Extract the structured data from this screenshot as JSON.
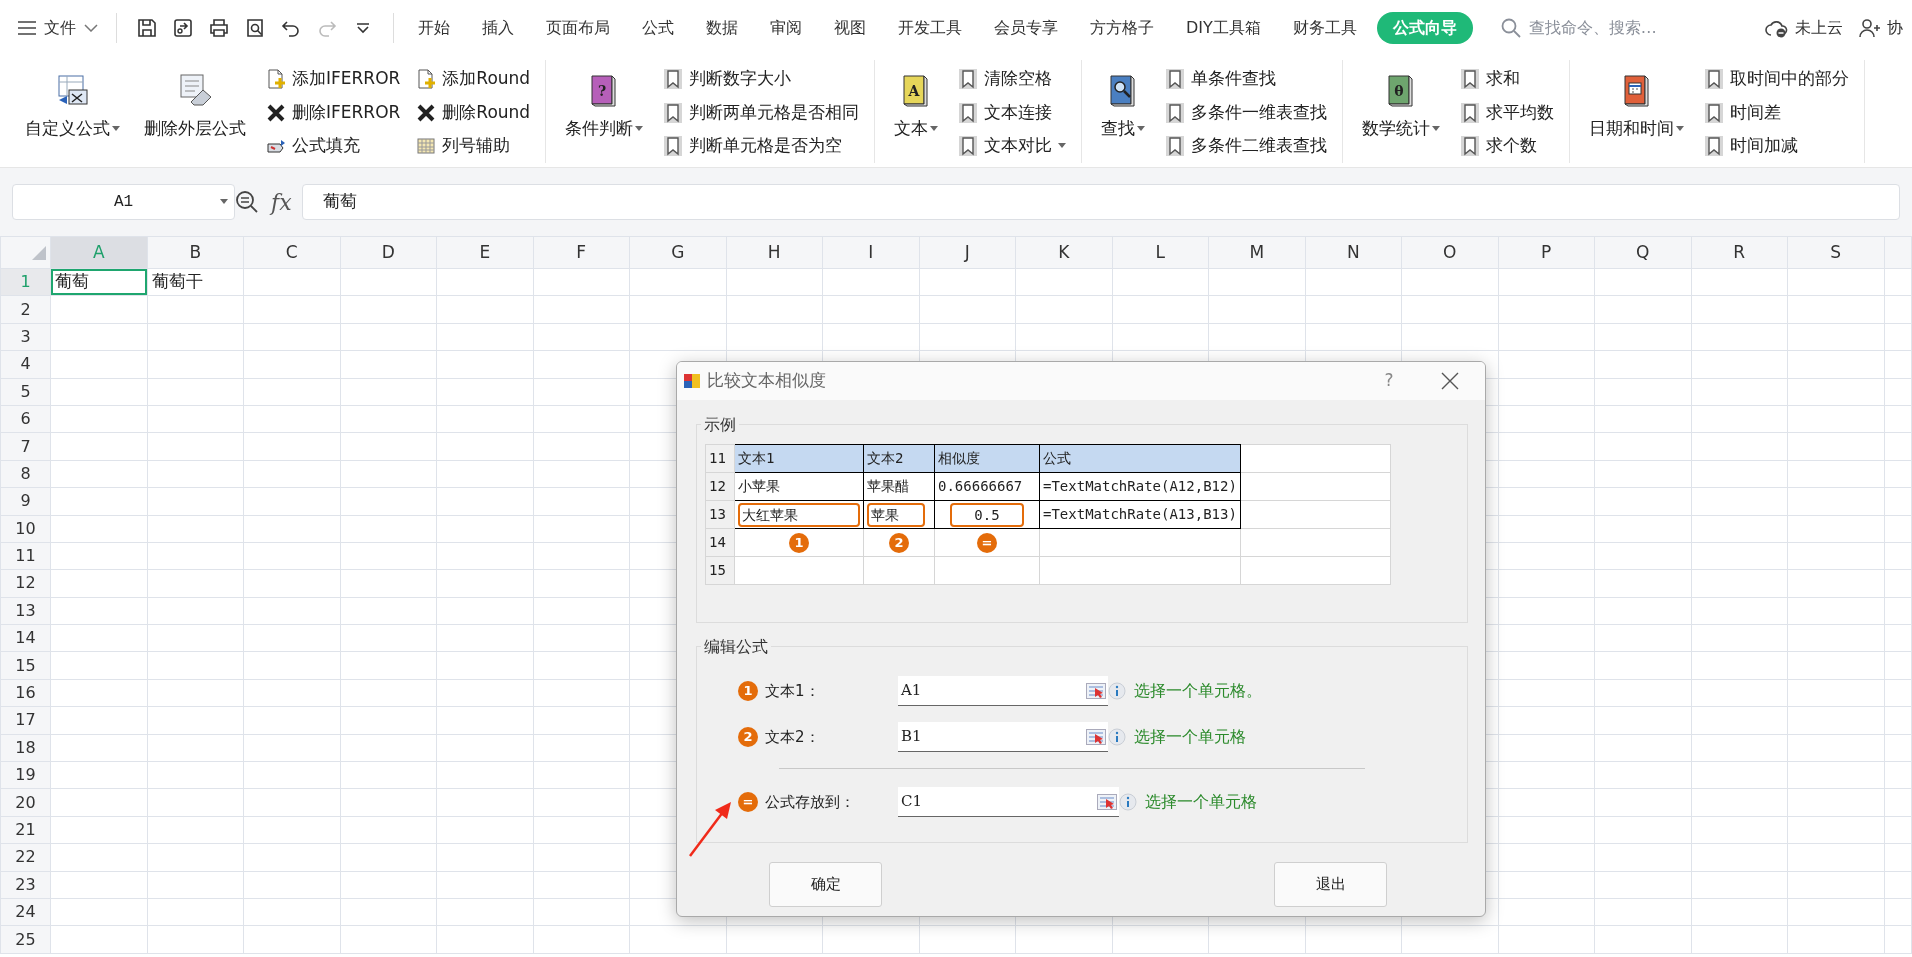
{
  "app_menu": {
    "label": "文件"
  },
  "menu_tabs": [
    {
      "label": "开始",
      "selected": false
    },
    {
      "label": "插入",
      "selected": false
    },
    {
      "label": "页面布局",
      "selected": false
    },
    {
      "label": "公式",
      "selected": false
    },
    {
      "label": "数据",
      "selected": false
    },
    {
      "label": "审阅",
      "selected": false
    },
    {
      "label": "视图",
      "selected": false
    },
    {
      "label": "开发工具",
      "selected": false
    },
    {
      "label": "会员专享",
      "selected": false
    },
    {
      "label": "方方格子",
      "selected": false
    },
    {
      "label": "DIY工具箱",
      "selected": false
    },
    {
      "label": "财务工具",
      "selected": false
    },
    {
      "label": "公式向导",
      "selected": true
    }
  ],
  "search": {
    "placeholder": "查找命令、搜索…"
  },
  "cloud_status": "未上云",
  "collaborate": "协",
  "ribbon": [
    {
      "large": [
        {
          "label": "自定义公式",
          "dropdown": true
        },
        {
          "label": "删除外层公式",
          "dropdown": false
        }
      ],
      "columns": [
        [
          {
            "label": "添加IFERROR",
            "dropdown": false
          },
          {
            "label": "删除IFERROR",
            "dropdown": false
          },
          {
            "label": "公式填充",
            "dropdown": false
          }
        ],
        [
          {
            "label": "添加Round",
            "dropdown": false
          },
          {
            "label": "删除Round",
            "dropdown": false
          },
          {
            "label": "列号辅助",
            "dropdown": false
          }
        ]
      ]
    },
    {
      "large": [
        {
          "label": "条件判断",
          "glyph": "?",
          "dropdown": true
        }
      ],
      "columns": [
        [
          {
            "label": "判断数字大小",
            "dropdown": false
          },
          {
            "label": "判断两单元格是否相同",
            "dropdown": false
          },
          {
            "label": "判断单元格是否为空",
            "dropdown": false
          }
        ]
      ]
    },
    {
      "large": [
        {
          "label": "文本",
          "glyph": "A",
          "dropdown": true
        }
      ],
      "columns": [
        [
          {
            "label": "清除空格",
            "dropdown": false
          },
          {
            "label": "文本连接",
            "dropdown": false
          },
          {
            "label": "文本对比",
            "dropdown": true
          }
        ]
      ]
    },
    {
      "large": [
        {
          "label": "查找",
          "dropdown": true
        }
      ],
      "columns": [
        [
          {
            "label": "单条件查找",
            "dropdown": false
          },
          {
            "label": "多条件一维表查找",
            "dropdown": false
          },
          {
            "label": "多条件二维表查找",
            "dropdown": false
          }
        ]
      ]
    },
    {
      "large": [
        {
          "label": "数学统计",
          "glyph": "θ",
          "dropdown": true
        }
      ],
      "columns": [
        [
          {
            "label": "求和",
            "dropdown": false
          },
          {
            "label": "求平均数",
            "dropdown": false
          },
          {
            "label": "求个数",
            "dropdown": false
          }
        ]
      ]
    },
    {
      "large": [
        {
          "label": "日期和时间",
          "dropdown": true
        }
      ],
      "columns": [
        [
          {
            "label": "取时间中的部分",
            "dropdown": false
          },
          {
            "label": "时间差",
            "dropdown": false
          },
          {
            "label": "时间加减",
            "dropdown": false
          }
        ]
      ]
    }
  ],
  "formula_bar": {
    "name_box": "A1",
    "function_label": "fx",
    "formula": "葡萄"
  },
  "sheet": {
    "columns": [
      {
        "label": "A",
        "selected": true
      },
      {
        "label": "B",
        "selected": false
      },
      {
        "label": "C",
        "selected": false
      },
      {
        "label": "D",
        "selected": false
      },
      {
        "label": "E",
        "selected": false
      },
      {
        "label": "F",
        "selected": false
      },
      {
        "label": "G",
        "selected": false
      },
      {
        "label": "H",
        "selected": false
      },
      {
        "label": "I",
        "selected": false
      },
      {
        "label": "J",
        "selected": false
      },
      {
        "label": "K",
        "selected": false
      },
      {
        "label": "L",
        "selected": false
      },
      {
        "label": "M",
        "selected": false
      },
      {
        "label": "N",
        "selected": false
      },
      {
        "label": "O",
        "selected": false
      },
      {
        "label": "P",
        "selected": false
      },
      {
        "label": "Q",
        "selected": false
      },
      {
        "label": "R",
        "selected": false
      },
      {
        "label": "S",
        "selected": false
      }
    ],
    "rows": [
      {
        "label": "1",
        "selected": true,
        "cells": [
          {
            "text": "葡萄",
            "selected": true
          },
          {
            "text": "葡萄干",
            "selected": false
          }
        ]
      },
      {
        "label": "2",
        "selected": false
      },
      {
        "label": "3",
        "selected": false
      },
      {
        "label": "4",
        "selected": false
      },
      {
        "label": "5",
        "selected": false
      },
      {
        "label": "6",
        "selected": false
      },
      {
        "label": "7",
        "selected": false
      },
      {
        "label": "8",
        "selected": false
      },
      {
        "label": "9",
        "selected": false
      },
      {
        "label": "10",
        "selected": false
      },
      {
        "label": "11",
        "selected": false
      },
      {
        "label": "12",
        "selected": false
      },
      {
        "label": "13",
        "selected": false
      },
      {
        "label": "14",
        "selected": false
      },
      {
        "label": "15",
        "selected": false
      },
      {
        "label": "16",
        "selected": false
      },
      {
        "label": "17",
        "selected": false
      },
      {
        "label": "18",
        "selected": false
      },
      {
        "label": "19",
        "selected": false
      },
      {
        "label": "20",
        "selected": false
      },
      {
        "label": "21",
        "selected": false
      },
      {
        "label": "22",
        "selected": false
      },
      {
        "label": "23",
        "selected": false
      },
      {
        "label": "24",
        "selected": false
      },
      {
        "label": "25",
        "selected": false
      }
    ]
  },
  "dialog": {
    "title": "比较文本相似度",
    "help": "?",
    "example": {
      "legend": "示例",
      "rows": [
        {
          "label": "11",
          "kind": "header",
          "cells": [
            {
              "text": "文本1"
            },
            {
              "text": "文本2"
            },
            {
              "text": "相似度"
            },
            {
              "text": "公式"
            }
          ]
        },
        {
          "label": "12",
          "kind": "data",
          "cells": [
            {
              "text": "小苹果",
              "highlighted": false
            },
            {
              "text": "苹果醋",
              "highlighted": false
            },
            {
              "text": "0.66666667",
              "highlighted": false
            },
            {
              "text": "=TextMatchRate(A12,B12)",
              "highlighted": false
            }
          ]
        },
        {
          "label": "13",
          "kind": "data",
          "cells": [
            {
              "text": "大红苹果",
              "highlighted": true
            },
            {
              "text": "苹果",
              "highlighted": true
            },
            {
              "text": "0.5",
              "highlighted": true
            },
            {
              "text": "=TextMatchRate(A13,B13)",
              "highlighted": false
            }
          ]
        },
        {
          "label": "14",
          "kind": "badges",
          "cells": [
            {
              "badge": "1"
            },
            {
              "badge": "2"
            },
            {
              "badge": "="
            }
          ]
        },
        {
          "label": "15",
          "kind": "empty"
        }
      ]
    },
    "editor": {
      "legend": "编辑公式",
      "fields": [
        {
          "badge": "1",
          "label": "文本1：",
          "value": "A1",
          "hint": "选择一个单元格。",
          "divider_before": false
        },
        {
          "badge": "2",
          "label": "文本2：",
          "value": "B1",
          "hint": "选择一个单元格",
          "divider_before": false
        },
        {
          "badge": "=",
          "label": "公式存放到：",
          "value": "C1",
          "hint": "选择一个单元格",
          "divider_before": true
        }
      ]
    },
    "buttons": [
      {
        "label": "确定"
      },
      {
        "label": "退出"
      }
    ]
  }
}
